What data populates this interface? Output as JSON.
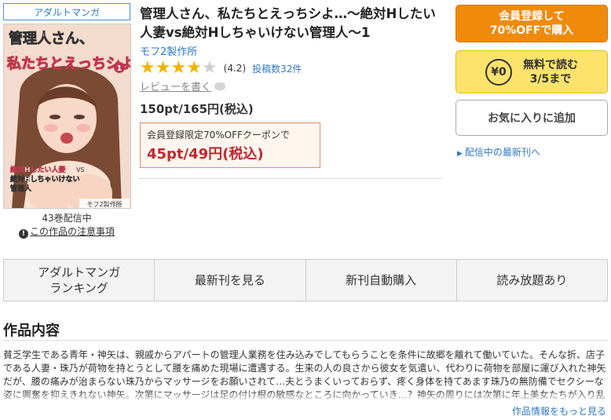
{
  "category_badge": "アダルトマンガ",
  "cover": {
    "title_line1": "管理人さん、",
    "title_line2": "私たちとえっちシよ…",
    "volume": "1",
    "subtitle_a": "絶対Hしたい人妻",
    "subtitle_b": "VS",
    "subtitle_c": "絶対Hしちゃいけない",
    "subtitle_d": "管理人",
    "publisher": "モフ2製作所"
  },
  "volume_count": "43巻配信中",
  "caution_link": "この作品の注意事項",
  "book": {
    "title": "管理人さん、私たちとえっちシよ…～絶対Hしたい人妻vs絶対Hしちゃいけない管理人～1",
    "author": "モフ2製作所",
    "rating_value": 4.2,
    "rating_text": "(4.2)",
    "post_count": "投稿数32件",
    "review_link": "レビューを書く",
    "price": "150pt/165円(税込)",
    "coupon_label": "会員登録限定70%OFFクーポンで",
    "coupon_price": "45pt/49円(税込)"
  },
  "buttons": {
    "register_line1": "会員登録して",
    "register_line2": "70%OFFで購入",
    "free_coin": "¥0",
    "free_line1": "無料で読む",
    "free_line2": "3/5まで",
    "favorite": "お気に入りに追加"
  },
  "latest_link": "配信中の最新刊へ",
  "tabs": [
    {
      "line1": "アダルトマンガ",
      "line2": "ランキング"
    },
    {
      "line1": "最新刊を見る",
      "line2": ""
    },
    {
      "line1": "新刊自動購入",
      "line2": ""
    },
    {
      "line1": "読み放題あり",
      "line2": ""
    }
  ],
  "section_title": "作品内容",
  "description": "貧乏学生である青年・神矢は、親戚からアパートの管理人業務を住み込みでしてもらうことを条件に故郷を離れて働いていた。そんな折、店子である人妻・珠乃が荷物を持とうとして腰を痛めた現場に遭遇する。生来の人の良さから彼女を気遣い、代わりに荷物を部屋に運び入れた神矢だが、腰の痛みが治まらない珠乃からマッサージをお願いされて…夫とうまくいっておらず、疼く身体を持てあます珠乃の無防備でセクシーな姿に興奮を抑えきれない神矢。次第にマッサージは足の付け根の敏感なところに向かっていき…？神矢の周りには次第に年上美女たちが入り乱",
  "more_link": "作品情報をもっと見る"
}
